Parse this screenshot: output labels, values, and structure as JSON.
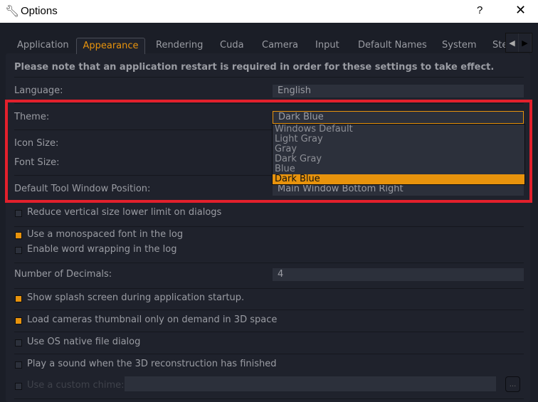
{
  "window": {
    "title": "Options",
    "icon": "wrench-icon",
    "help_label": "?",
    "close_label": "✕"
  },
  "tabs": [
    {
      "label": "Application"
    },
    {
      "label": "Appearance",
      "active": true
    },
    {
      "label": "Rendering"
    },
    {
      "label": "Cuda"
    },
    {
      "label": "Camera"
    },
    {
      "label": "Input"
    },
    {
      "label": "Default Names"
    },
    {
      "label": "System"
    },
    {
      "label": "Ste"
    }
  ],
  "tab_scroll": {
    "left": "◀",
    "right": "▶"
  },
  "notice": "Please note that an application restart is required in order for these settings to take effect.",
  "settings": {
    "language": {
      "label": "Language:",
      "value": "English"
    },
    "theme": {
      "label": "Theme:",
      "value": "Dark Blue",
      "options": [
        "Windows Default",
        "Light Gray",
        "Gray",
        "Dark Gray",
        "Blue",
        "Dark Blue"
      ],
      "selected": "Dark Blue"
    },
    "icon_size": {
      "label": "Icon Size:"
    },
    "font_size": {
      "label": "Font Size:"
    },
    "tool_window": {
      "label": "Default Tool Window Position:",
      "value": "Main Window Bottom Right"
    },
    "decimals": {
      "label": "Number of Decimals:",
      "value": "4"
    },
    "custom_chime": {
      "label": "Use a custom chime:",
      "value": "",
      "browse": "..."
    }
  },
  "checkboxes": [
    {
      "label": "Reduce vertical size lower limit on dialogs",
      "checked": false
    },
    {
      "label": "Use a monospaced font in the log",
      "checked": true
    },
    {
      "label": "Enable word wrapping in the log",
      "checked": false
    },
    {
      "label": "Show splash screen during application startup.",
      "checked": true
    },
    {
      "label": "Load cameras thumbnail only on demand in 3D space",
      "checked": true
    },
    {
      "label": "Use OS native file dialog",
      "checked": false
    },
    {
      "label": "Play a sound when the 3D reconstruction has finished",
      "checked": false
    },
    {
      "label": "Use a custom chime:",
      "checked": false
    }
  ],
  "colors": {
    "accent": "#e8930c",
    "highlight": "#e3202c",
    "background": "#1b1e27"
  }
}
